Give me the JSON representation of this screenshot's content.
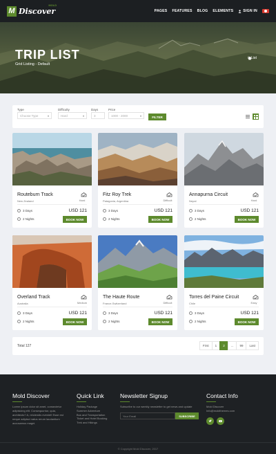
{
  "nav": {
    "logo_mark": "M",
    "logo_text": "Discover",
    "logo_sup": "MOLD",
    "links": [
      "PAGES",
      "FEATURES",
      "BLOG",
      "ELEMENTS"
    ],
    "sign_in": "SIGN IN"
  },
  "hero": {
    "title": "TRIP LIST",
    "subtitle": "Grid Listing - Default",
    "breadcrumb_sep": "/",
    "breadcrumb_current": "List"
  },
  "filter": {
    "type_label": "Type",
    "type_value": "Choose Type",
    "difficulty_label": "Difficulty",
    "difficulty_value": "Hard",
    "days_label": "Days",
    "days_value": "3",
    "price_label": "Price",
    "price_value": "1000 - 2000",
    "button": "FILTER"
  },
  "cards": [
    {
      "name": "Routeburn Track",
      "location": "New Zealand",
      "level": "Hard",
      "days": "3 Days",
      "nights": "2 Nights",
      "price": "USD 121",
      "button": "BOOK NOW"
    },
    {
      "name": "Fitz Roy Trek",
      "location": "Patagonia, Argentina",
      "level": "Difficult",
      "days": "3 Days",
      "nights": "2 Nights",
      "price": "USD 121",
      "button": "BOOK NOW"
    },
    {
      "name": "Annapurna Circuit",
      "location": "Nepal",
      "level": "Hard",
      "days": "3 Days",
      "nights": "2 Nights",
      "price": "USD 121",
      "button": "BOOK NOW"
    },
    {
      "name": "Overland Track",
      "location": "Australia",
      "level": "Medium",
      "days": "3 Days",
      "nights": "2 Nights",
      "price": "USD 121",
      "button": "BOOK NOW"
    },
    {
      "name": "The Haute Route",
      "location": "France-Switzerland",
      "level": "Difficult",
      "days": "3 Days",
      "nights": "2 Nights",
      "price": "USD 121",
      "button": "BOOK NOW"
    },
    {
      "name": "Torres del Paine Circuit",
      "location": "Chile",
      "level": "Easy",
      "days": "3 Days",
      "nights": "2 Nights",
      "price": "USD 121",
      "button": "BOOK NOW"
    }
  ],
  "pagination": {
    "total": "Total 127",
    "first": "First",
    "pages": [
      "1",
      "2",
      "...",
      "99"
    ],
    "last": "Last",
    "active": "2"
  },
  "footer": {
    "about_title": "Mold Discover",
    "about_text": "Lorem ipsum dolor sit amet, consectetur adipisicing elit. Consequuntur, quia, architecto? A, reiciendis eveniet! Esse est neque adipisci natus rerum laudantium accusamus magni.",
    "links_title": "Quick Link",
    "links": [
      "Holiday Package",
      "Summer Adventure",
      "Bus and Transportation",
      "Ticket and Hotel Booking",
      "Trek and Hikings"
    ],
    "news_title": "Newsletter Signup",
    "news_text": "Subscribe to our weekly newsletter to get news and update",
    "news_placeholder": "Your Email",
    "news_button": "SUBSCRIBE",
    "contact_title": "Contact Info",
    "contact_name": "Mold Discover",
    "contact_email": "Info@moldthemes.com",
    "copyright": "© Copyright Mold Discover, 2017"
  },
  "colors": {
    "accent": "#5d8a2d",
    "nav_bg": "#1c1f22",
    "footer_bg": "#1e2124",
    "page_bg": "#eef0f4"
  }
}
